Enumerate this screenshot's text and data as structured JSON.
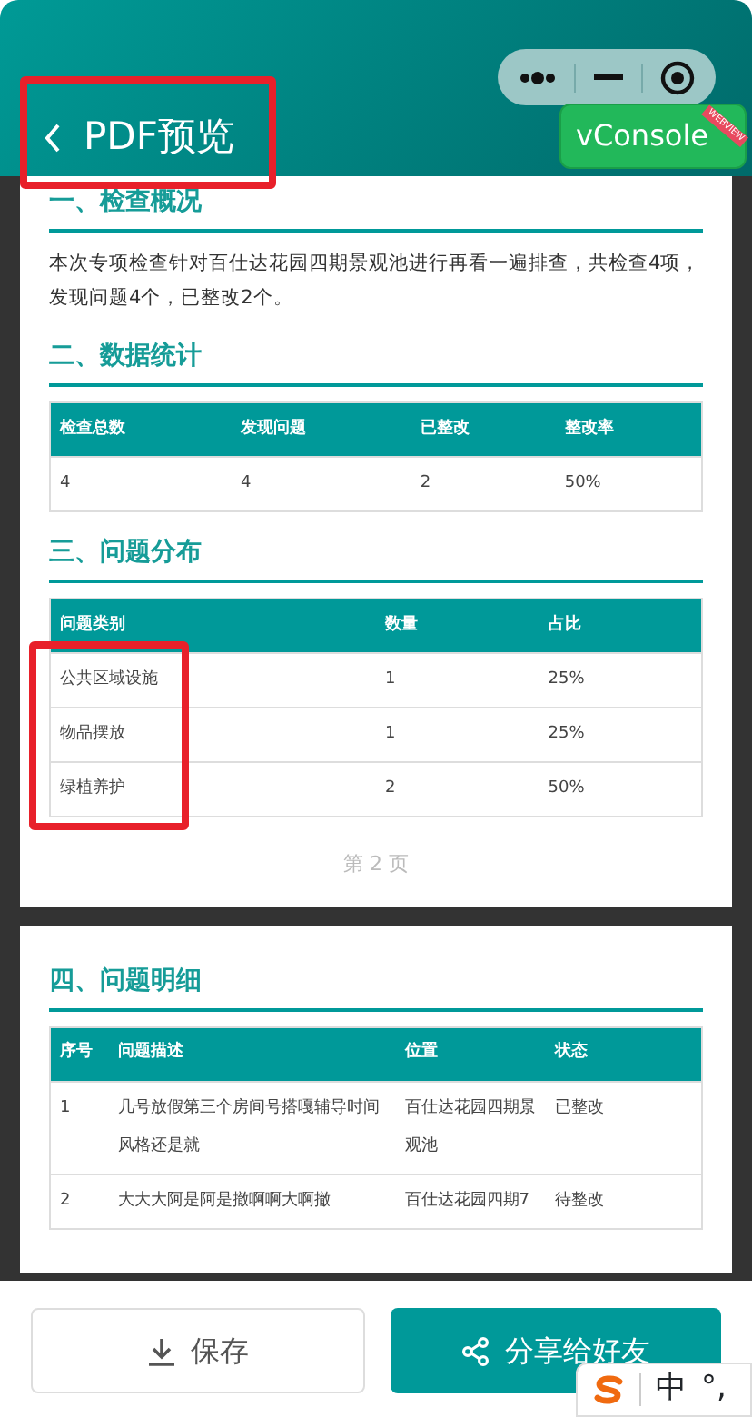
{
  "header": {
    "title": "PDF预览",
    "highlighted": true
  },
  "vconsole": {
    "label": "vConsole",
    "ribbon": "WEBVIEW"
  },
  "pages": [
    {
      "sections": [
        {
          "title": "一、检查概况",
          "paragraph": "本次专项检查针对百仕达花园四期景观池进行再看一遍排查，共检查4项，发现问题4个，已整改2个。"
        },
        {
          "title": "二、数据统计",
          "table": {
            "columns": [
              {
                "label": "检查总数",
                "highlighted": false
              },
              {
                "label": "发现问题",
                "highlighted": false
              },
              {
                "label": "已整改",
                "highlighted": false
              },
              {
                "label": "整改率",
                "highlighted": false
              }
            ],
            "rows": [
              [
                "4",
                "4",
                "2",
                "50%"
              ]
            ]
          }
        },
        {
          "title": "三、问题分布",
          "table": {
            "columns": [
              {
                "label": "问题类别",
                "highlighted": true
              },
              {
                "label": "数量",
                "highlighted": false
              },
              {
                "label": "占比",
                "highlighted": false
              }
            ],
            "rows": [
              [
                "公共区域设施",
                "1",
                "25%"
              ],
              [
                "物品摆放",
                "1",
                "25%"
              ],
              [
                "绿植养护",
                "2",
                "50%"
              ]
            ]
          }
        }
      ],
      "page_number": "第 2 页"
    },
    {
      "sections": [
        {
          "title": "四、问题明细",
          "table": {
            "columns": [
              {
                "label": "序号",
                "highlighted": false
              },
              {
                "label": "问题描述",
                "highlighted": false
              },
              {
                "label": "位置",
                "highlighted": false
              },
              {
                "label": "状态",
                "highlighted": false
              }
            ],
            "rows": [
              [
                "1",
                "几号放假第三个房间号搭嘎辅导时间风格还是就",
                "百仕达花园四期景观池",
                "已整改"
              ],
              [
                "2",
                "大大大阿是阿是撤啊啊大啊撤",
                "百仕达花园四期7",
                "待整改"
              ]
            ]
          }
        }
      ]
    }
  ],
  "actions": [
    {
      "label": "保存",
      "kind": "outline"
    },
    {
      "label": "分享给好友",
      "kind": "primary"
    }
  ],
  "ime_bar": {
    "mode": "中",
    "punctuation": "°,"
  }
}
